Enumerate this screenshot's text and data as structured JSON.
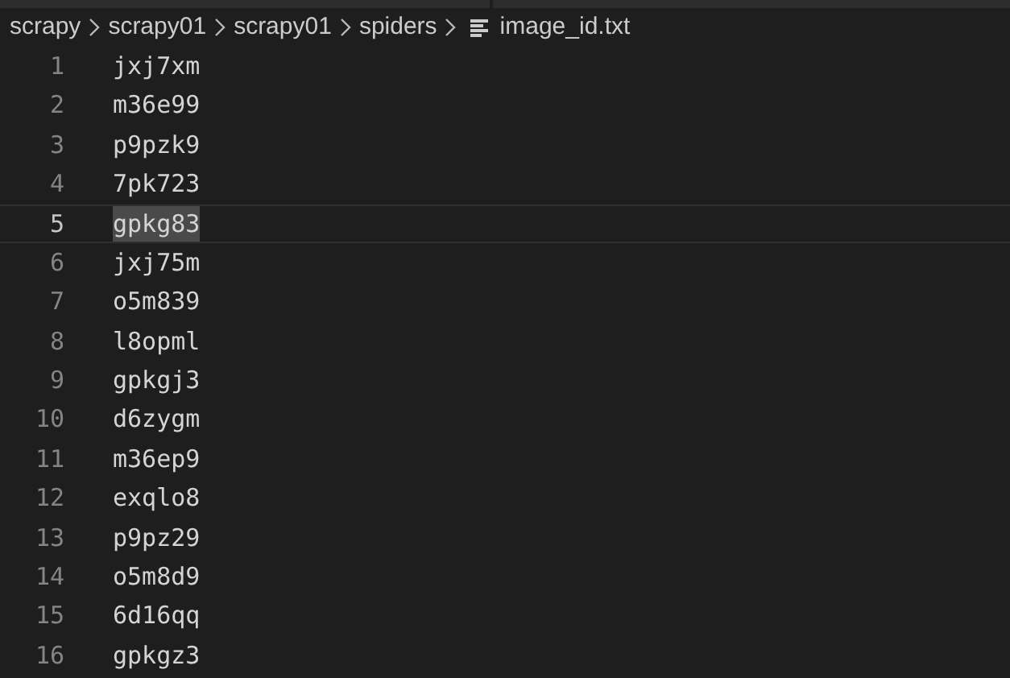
{
  "breadcrumb": {
    "folders": [
      "scrapy",
      "scrapy01",
      "scrapy01",
      "spiders"
    ],
    "file": "image_id.txt"
  },
  "lines": [
    {
      "number": "1",
      "text": "jxj7xm",
      "current": false,
      "selected": false
    },
    {
      "number": "2",
      "text": "m36e99",
      "current": false,
      "selected": false
    },
    {
      "number": "3",
      "text": "p9pzk9",
      "current": false,
      "selected": false
    },
    {
      "number": "4",
      "text": "7pk723",
      "current": false,
      "selected": false
    },
    {
      "number": "5",
      "text": "gpkg83",
      "current": true,
      "selected": true
    },
    {
      "number": "6",
      "text": "jxj75m",
      "current": false,
      "selected": false
    },
    {
      "number": "7",
      "text": "o5m839",
      "current": false,
      "selected": false
    },
    {
      "number": "8",
      "text": "l8opml",
      "current": false,
      "selected": false
    },
    {
      "number": "9",
      "text": "gpkgj3",
      "current": false,
      "selected": false
    },
    {
      "number": "10",
      "text": "d6zygm",
      "current": false,
      "selected": false
    },
    {
      "number": "11",
      "text": "m36ep9",
      "current": false,
      "selected": false
    },
    {
      "number": "12",
      "text": "exqlo8",
      "current": false,
      "selected": false
    },
    {
      "number": "13",
      "text": "p9pz29",
      "current": false,
      "selected": false
    },
    {
      "number": "14",
      "text": "o5m8d9",
      "current": false,
      "selected": false
    },
    {
      "number": "15",
      "text": "6d16qq",
      "current": false,
      "selected": false
    },
    {
      "number": "16",
      "text": "gpkgz3",
      "current": false,
      "selected": false
    }
  ]
}
